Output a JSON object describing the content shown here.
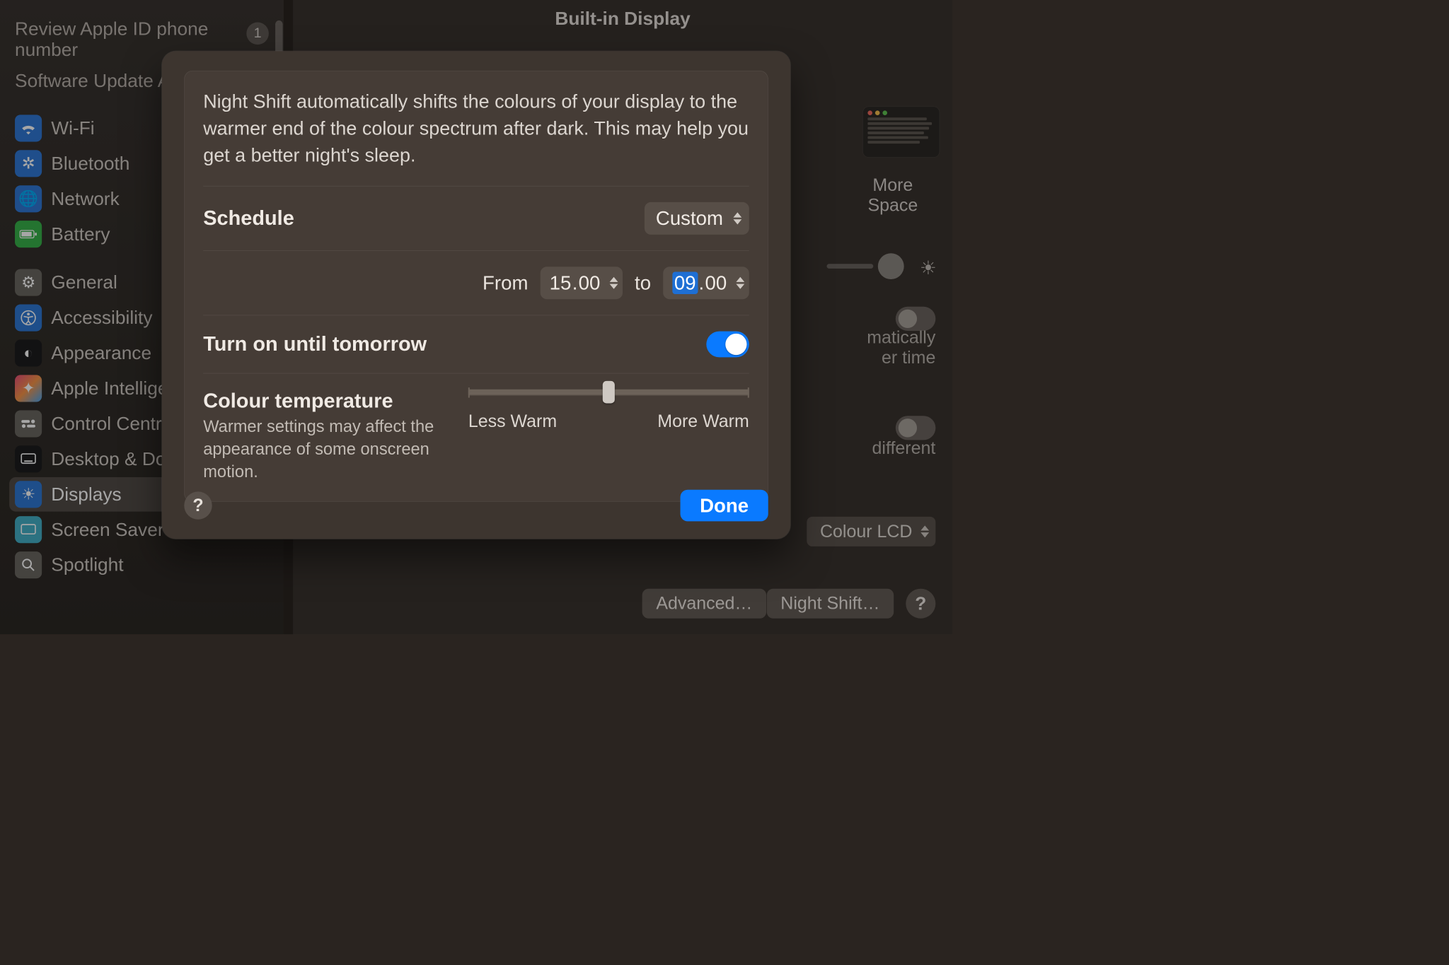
{
  "header": {
    "title": "Built-in Display"
  },
  "sidebar": {
    "notices": [
      {
        "label": "Review Apple ID phone number",
        "badge": "1"
      },
      {
        "label": "Software Update Available"
      }
    ],
    "group1": [
      {
        "label": "Wi-Fi",
        "icon": "wifi"
      },
      {
        "label": "Bluetooth",
        "icon": "bluetooth"
      },
      {
        "label": "Network",
        "icon": "network"
      },
      {
        "label": "Battery",
        "icon": "battery"
      }
    ],
    "group2": [
      {
        "label": "General",
        "icon": "general"
      },
      {
        "label": "Accessibility",
        "icon": "accessibility"
      },
      {
        "label": "Appearance",
        "icon": "appearance"
      },
      {
        "label": "Apple Intelligence",
        "icon": "apple-intelligence"
      },
      {
        "label": "Control Centre",
        "icon": "control-centre"
      },
      {
        "label": "Desktop & Dock",
        "icon": "desktop-dock"
      },
      {
        "label": "Displays",
        "icon": "displays",
        "selected": true
      },
      {
        "label": "Screen Saver",
        "icon": "screen-saver"
      },
      {
        "label": "Spotlight",
        "icon": "spotlight"
      }
    ]
  },
  "main": {
    "resolution_label": "More Space",
    "right_text_1a": "matically",
    "right_text_1b": "er time",
    "right_text_2": "different",
    "colour_profile": "Colour LCD",
    "advanced_btn": "Advanced…",
    "nightshift_btn": "Night Shift…"
  },
  "sheet": {
    "description": "Night Shift automatically shifts the colours of your display to the warmer end of the colour spectrum after dark. This may help you get a better night's sleep.",
    "schedule": {
      "label": "Schedule",
      "value": "Custom",
      "from_label": "From",
      "to_label": "to",
      "from_h": "15",
      "from_m": "00",
      "to_h": "09",
      "to_m": "00"
    },
    "turn_on": {
      "label": "Turn on until tomorrow",
      "value": true
    },
    "temperature": {
      "label": "Colour temperature",
      "sub": "Warmer settings may affect the appearance of some onscreen motion.",
      "min_label": "Less Warm",
      "max_label": "More Warm",
      "value_pct": 50
    },
    "done": "Done"
  }
}
